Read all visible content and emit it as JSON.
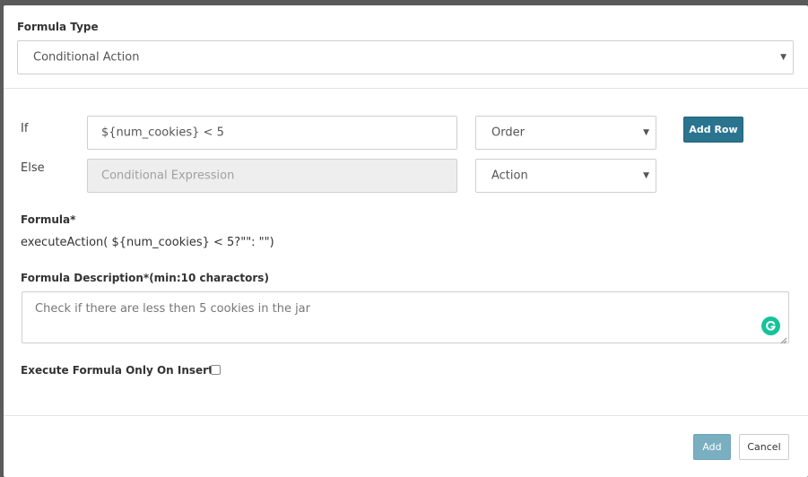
{
  "formula_type": {
    "label": "Formula Type",
    "selected": "Conditional Action"
  },
  "condition_rows": {
    "if": {
      "label": "If",
      "expression": "${num_cookies} < 5",
      "action": "Order"
    },
    "else": {
      "label": "Else",
      "expression_placeholder": "Conditional Expression",
      "action": "Action"
    },
    "add_row_label": "Add Row"
  },
  "formula": {
    "label": "Formula*",
    "value": "executeAction( ${num_cookies} < 5?\"\": \"\")"
  },
  "description": {
    "label": "Formula Description*(min:10 charactors)",
    "value": "Check if there are less then 5 cookies in the jar"
  },
  "insert_only": {
    "label": "Execute Formula Only On Insert",
    "checked": false
  },
  "footer": {
    "add_label": "Add",
    "cancel_label": "Cancel"
  },
  "colors": {
    "primary": "#2a7490",
    "primary_disabled": "#7aafc1",
    "grammarly": "#15c39a"
  },
  "icons": {
    "dropdown": "caret-down-icon",
    "grammarly": "grammarly-icon",
    "resize": "resize-handle-icon"
  }
}
